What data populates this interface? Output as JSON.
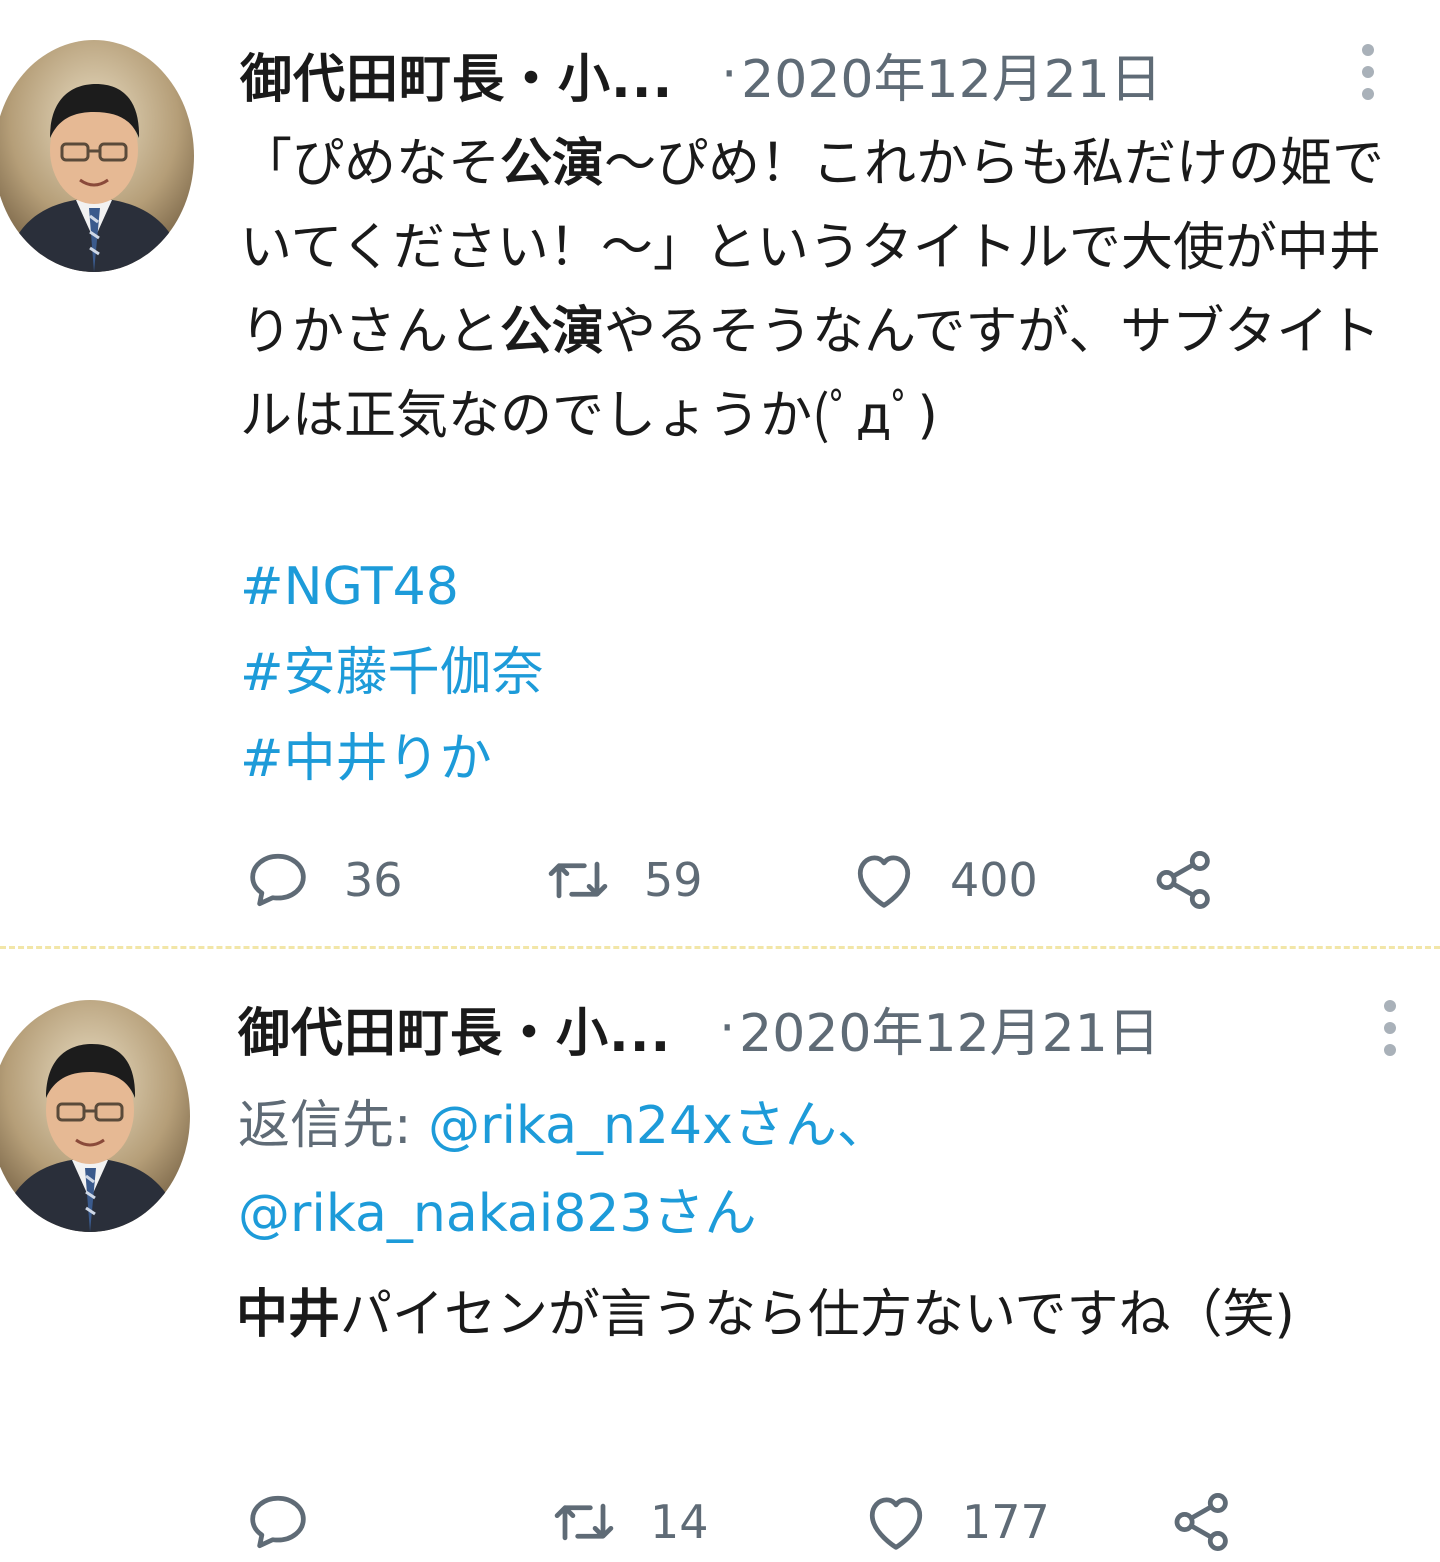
{
  "tweets": [
    {
      "display_name": "御代田町長・小...",
      "separator": "·",
      "date": "2020年12月21日",
      "body": {
        "p1": "「ぴめなそ",
        "b1": "公演",
        "p2": "〜ぴめ！これからも私だけの姫でいてください！〜」というタイトルで大使が中井りかさんと",
        "b2": "公演",
        "p3": "やるそうなんですが、サブタイトルは正気なのでしょうか(ﾟдﾟ)"
      },
      "hashtags": [
        "#NGT48",
        "#安藤千伽奈",
        "#中井りか"
      ],
      "stats": {
        "replies": "36",
        "retweets": "59",
        "likes": "400"
      }
    },
    {
      "display_name": "御代田町長・小...",
      "separator": "·",
      "date": "2020年12月21日",
      "reply_to": {
        "label": "返信先: ",
        "mention1": "@rika_n24xさん",
        "sep": "、",
        "mention2": "@rika_nakai823さん"
      },
      "body": {
        "b1": "中井",
        "p1": "パイセンが言うなら仕方ないですね（笑)"
      },
      "stats": {
        "replies": "",
        "retweets": "14",
        "likes": "177"
      }
    }
  ],
  "colors": {
    "link": "#1d9bd9",
    "muted": "#5f6b76",
    "text": "#1a1a1a",
    "divider": "#f2e6a8"
  },
  "icons": [
    "more-vertical-icon",
    "reply-icon",
    "retweet-icon",
    "like-icon",
    "share-icon"
  ]
}
